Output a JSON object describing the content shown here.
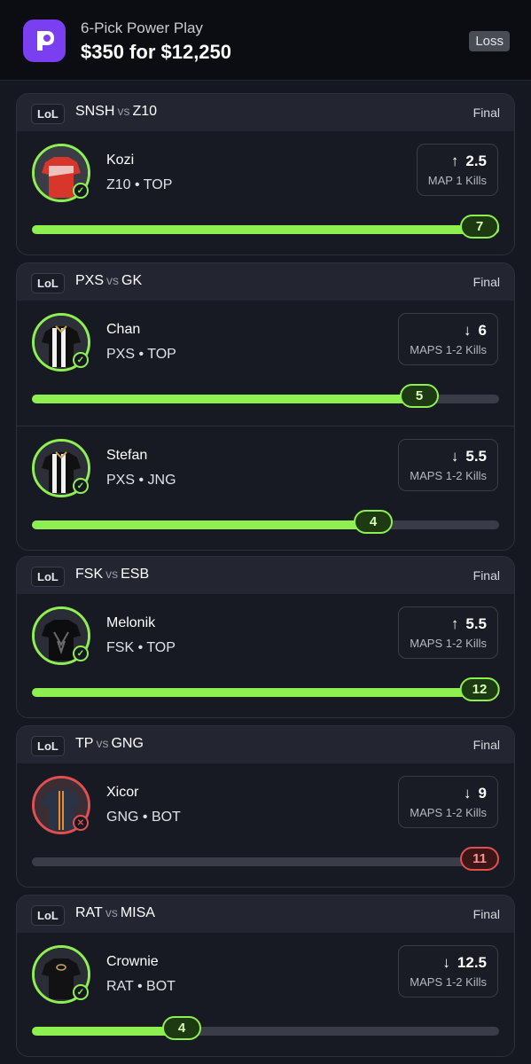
{
  "header": {
    "title": "6-Pick Power Play",
    "payout": "$350 for $12,250",
    "result": "Loss"
  },
  "colors": {
    "win": "#8ef050",
    "loss": "#e05050",
    "brand": "#7b3ff2"
  },
  "matches": [
    {
      "game": "LoL",
      "team_a": "SNSH",
      "vs": "vs",
      "team_b": "Z10",
      "status": "Final",
      "picks": [
        {
          "name": "Kozi",
          "meta": "Z10 • TOP",
          "direction": "up",
          "arrow": "↑",
          "line": "2.5",
          "stat": "MAP 1 Kills",
          "actual": "7",
          "progress": 1.0,
          "result": "win",
          "jersey": "red"
        }
      ]
    },
    {
      "game": "LoL",
      "team_a": "PXS",
      "vs": "vs",
      "team_b": "GK",
      "status": "Final",
      "picks": [
        {
          "name": "Chan",
          "meta": "PXS • TOP",
          "direction": "down",
          "arrow": "↓",
          "line": "6",
          "stat": "MAPS 1-2 Kills",
          "actual": "5",
          "progress": 0.83,
          "result": "win",
          "jersey": "stripes"
        },
        {
          "name": "Stefan",
          "meta": "PXS • JNG",
          "direction": "down",
          "arrow": "↓",
          "line": "5.5",
          "stat": "MAPS 1-2 Kills",
          "actual": "4",
          "progress": 0.73,
          "result": "win",
          "jersey": "stripes"
        }
      ]
    },
    {
      "game": "LoL",
      "team_a": "FSK",
      "vs": "vs",
      "team_b": "ESB",
      "status": "Final",
      "picks": [
        {
          "name": "Melonik",
          "meta": "FSK • TOP",
          "direction": "up",
          "arrow": "↑",
          "line": "5.5",
          "stat": "MAPS 1-2 Kills",
          "actual": "12",
          "progress": 1.0,
          "result": "win",
          "jersey": "black"
        }
      ]
    },
    {
      "game": "LoL",
      "team_a": "TP",
      "vs": "vs",
      "team_b": "GNG",
      "status": "Final",
      "picks": [
        {
          "name": "Xicor",
          "meta": "GNG • BOT",
          "direction": "down",
          "arrow": "↓",
          "line": "9",
          "stat": "MAPS 1-2 Kills",
          "actual": "11",
          "progress": 1.0,
          "result": "loss",
          "jersey": "navy"
        }
      ]
    },
    {
      "game": "LoL",
      "team_a": "RAT",
      "vs": "vs",
      "team_b": "MISA",
      "status": "Final",
      "picks": [
        {
          "name": "Crownie",
          "meta": "RAT • BOT",
          "direction": "down",
          "arrow": "↓",
          "line": "12.5",
          "stat": "MAPS 1-2 Kills",
          "actual": "4",
          "progress": 0.32,
          "result": "win",
          "jersey": "black-gold"
        }
      ]
    }
  ]
}
